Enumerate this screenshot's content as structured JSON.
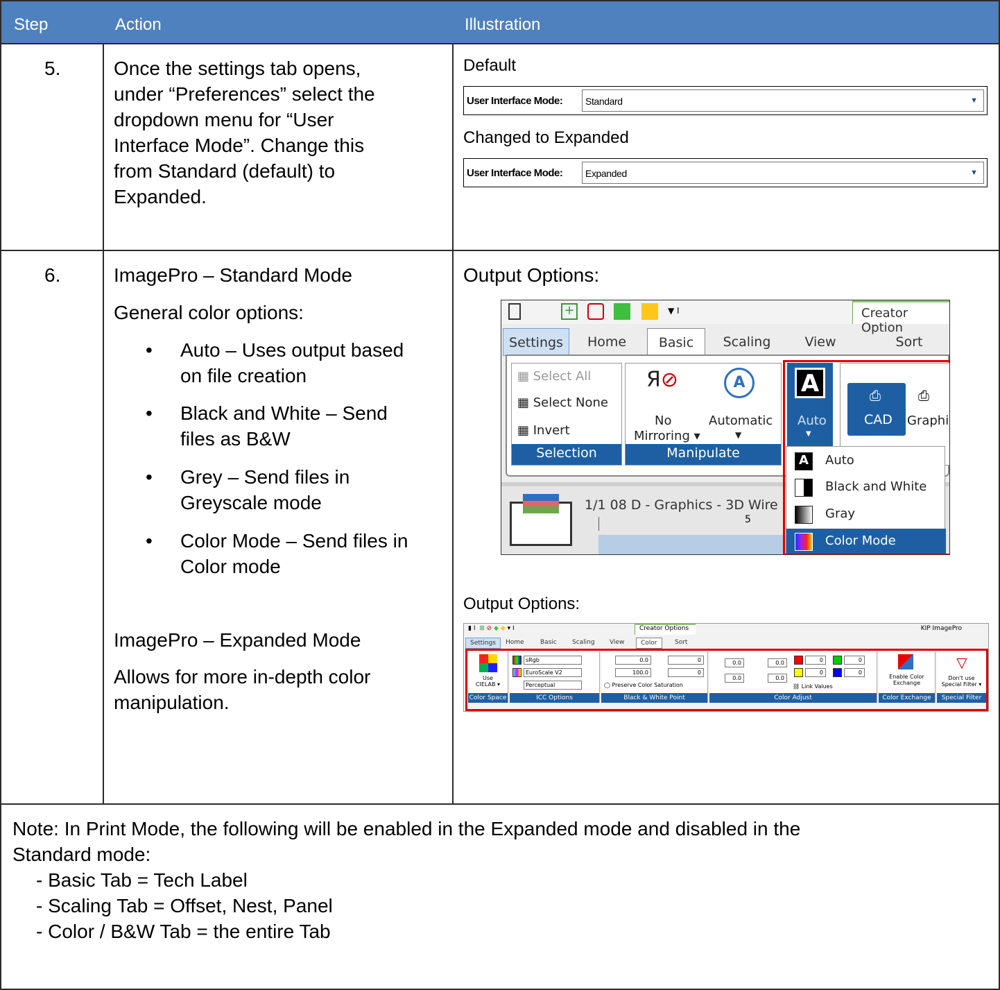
{
  "table": {
    "headers": {
      "step": "Step",
      "action": "Action",
      "illustration": "Illustration"
    }
  },
  "row5": {
    "step": "5.",
    "action_lines": [
      "Once the settings tab opens,",
      "under “Preferences” select the",
      "dropdown menu for “User",
      "Interface Mode”. Change this",
      "from Standard (default) to",
      "Expanded."
    ],
    "default_caption": "Default",
    "changed_caption": "Changed to Expanded",
    "ui_mode_label": "User Interface Mode:",
    "default_value": "Standard",
    "changed_value": "Expanded"
  },
  "row6": {
    "step": "6.",
    "standard_title": "ImagePro – Standard Mode",
    "general_label": "General color options:",
    "bullets": [
      [
        "Auto – Uses output based",
        "on file creation"
      ],
      [
        "Black and White – Send",
        "files as B&W"
      ],
      [
        "Grey – Send files in",
        "Greyscale mode"
      ],
      [
        "Color Mode – Send files in",
        "Color mode"
      ]
    ],
    "expanded_title": "ImagePro – Expanded Mode",
    "expanded_lines": [
      "Allows for more in-depth color",
      "manipulation."
    ],
    "output_options_1": "Output Options:",
    "output_options_2": "Output Options:"
  },
  "standard_ui": {
    "creator": "Creator Option",
    "tabs": [
      "Settings",
      "Home",
      "Basic",
      "Scaling",
      "View",
      "Sort"
    ],
    "selection": {
      "select_all": "Select All",
      "select_none": "Select None",
      "invert": "Invert",
      "footer": "Selection"
    },
    "manipulate": {
      "no_mirroring_1": "No",
      "no_mirroring_2": "Mirroring ▾",
      "automatic": "Automatic",
      "footer": "Manipulate"
    },
    "auto_button": "Auto",
    "cad": "CAD",
    "graphic": "Graphic",
    "doc_line": "1/1   08 D - Graphics - 3D Wire",
    "ruler_tick": "5",
    "menu_items": [
      "Auto",
      "Black and White",
      "Gray",
      "Color Mode"
    ],
    "colors": {
      "ribbon_blue": "#1e5fa3",
      "highlight_red": "#e00000"
    }
  },
  "expanded_ui": {
    "creator": "Creator Options",
    "app_title": "KIP ImagePro",
    "tabs": [
      "Settings",
      "Home",
      "Basic",
      "Scaling",
      "View",
      "Color",
      "Sort"
    ],
    "color_space": {
      "label_1": "Use",
      "label_2": "CIELAB ▾",
      "footer": "Color Space"
    },
    "icc": {
      "opt1": "sRgb",
      "opt2": "EuroScale V2",
      "opt3": "Perceptual",
      "footer": "ICC Options"
    },
    "bw_point": {
      "v1": "0.0",
      "v2": "100.0",
      "v3": "0",
      "v4": "0",
      "preserve": "Preserve Color Saturation",
      "footer": "Black & White Point"
    },
    "color_adjust": {
      "v1": "0.0",
      "v2": "0.0",
      "v3": "0.0",
      "v4": "0.0",
      "c1": "0",
      "c2": "0",
      "c3": "0",
      "c4": "0",
      "link": "Link Values",
      "footer": "Color Adjust"
    },
    "exchange": {
      "label_1": "Enable Color",
      "label_2": "Exchange",
      "footer": "Color Exchange"
    },
    "filter": {
      "label_1": "Don't use",
      "label_2": "Special Filter ▾",
      "footer": "Special Filter"
    }
  },
  "note": {
    "line1": "Note: In Print Mode, the following will be enabled in the Expanded mode and disabled in the",
    "line2": "Standard mode:",
    "items": [
      "- Basic Tab = Tech Label",
      "- Scaling Tab = Offset, Nest, Panel",
      "- Color / B&W Tab = the entire Tab"
    ]
  }
}
